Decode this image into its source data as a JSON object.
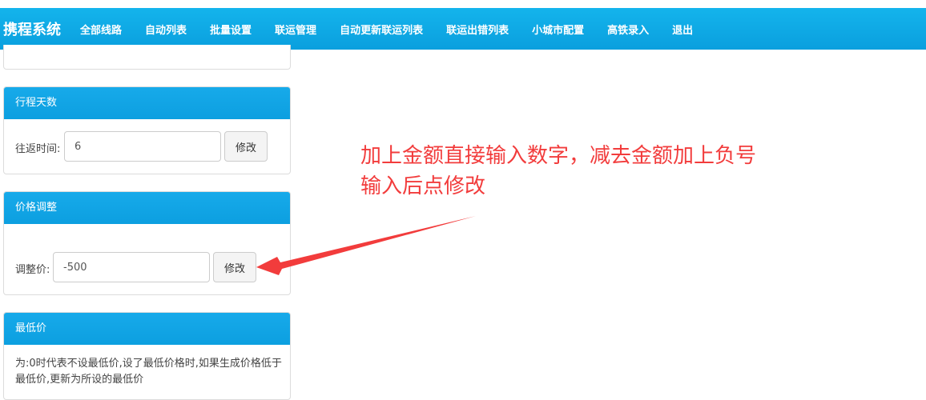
{
  "navbar": {
    "brand": "携程系统",
    "items": [
      "全部线路",
      "自动列表",
      "批量设置",
      "联运管理",
      "自动更新联运列表",
      "联运出错列表",
      "小城市配置",
      "高铁录入",
      "退出"
    ]
  },
  "trip_days": {
    "title": "行程天数",
    "label": "往返时间:",
    "value": "6",
    "button": "修改"
  },
  "price_adjust": {
    "title": "价格调整",
    "label": "调整价:",
    "value": "-500",
    "button": "修改"
  },
  "min_price": {
    "title": "最低价",
    "note": "为:0时代表不设最低价,设了最低价格时,如果生成价格低于最低价,更新为所设的最低价"
  },
  "annotation": {
    "line1": "加上金额直接输入数字，减去金额加上负号",
    "line2": "输入后点修改",
    "color": "#f23c3c"
  }
}
